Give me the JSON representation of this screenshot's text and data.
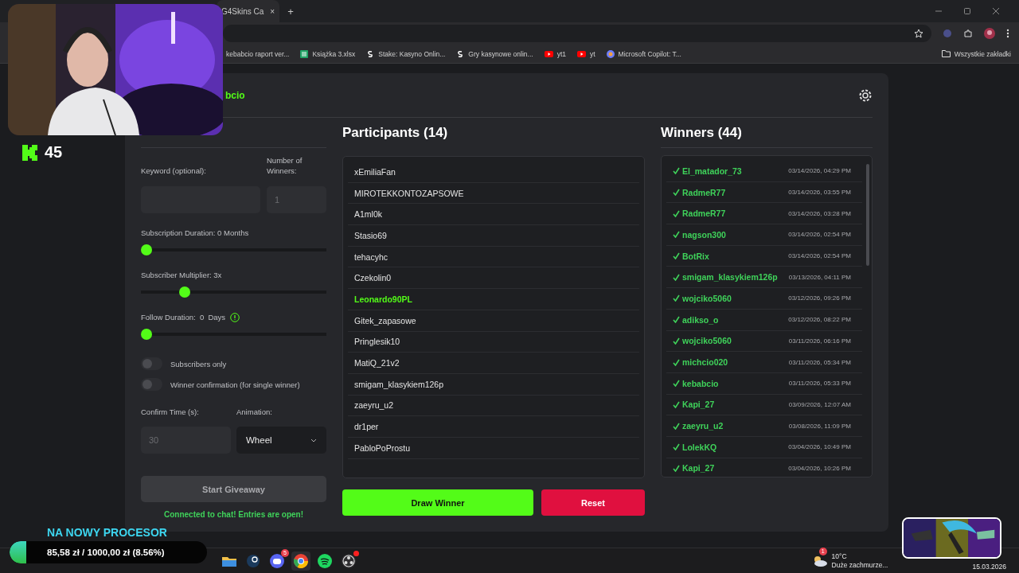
{
  "browser": {
    "tab": {
      "title": "G4Skins Ca",
      "close": "×"
    },
    "new_tab": "+",
    "bookmarks": [
      {
        "kind": "doc",
        "label": "kebabcio raport ver..."
      },
      {
        "kind": "sheet",
        "label": "Książka 3.xlsx"
      },
      {
        "kind": "stake",
        "label": "Stake: Kasyno Onlin..."
      },
      {
        "kind": "stake",
        "label": "Gry kasynowe onlin..."
      },
      {
        "kind": "youtube",
        "label": "yt1"
      },
      {
        "kind": "youtube",
        "label": "yt"
      },
      {
        "kind": "copilot",
        "label": "Microsoft Copilot: T..."
      }
    ],
    "all_bookmarks": "Wszystkie zakładki"
  },
  "app": {
    "header": {
      "name": "bcio"
    },
    "settings": {
      "keyword_label": "Keyword (optional):",
      "winners_label": "Number of Winners:",
      "winners_placeholder": "1",
      "sliders": [
        {
          "label": "Subscription Duration: 0 Months",
          "level": 0
        },
        {
          "label": "Subscriber Multiplier: 3x",
          "level": 0.22
        },
        {
          "label": "Follow Duration:  0  Days",
          "level": 0,
          "info": true
        }
      ],
      "toggles": [
        {
          "label": "Subscribers only",
          "on": false
        },
        {
          "label": "Winner confirmation (for single winner)",
          "on": false
        }
      ],
      "confirm_label": "Confirm Time (s):",
      "confirm_placeholder": "30",
      "animation_label": "Animation:",
      "animation_value": "Wheel",
      "start_button": "Start Giveaway",
      "status": "Connected to chat! Entries are open!"
    },
    "participants": {
      "title": "Participants (14)",
      "items": [
        {
          "name": "xEmiliaFan",
          "highlighted": false
        },
        {
          "name": "MIROTEKKONTOZAPSOWE",
          "highlighted": false
        },
        {
          "name": "A1ml0k",
          "highlighted": false
        },
        {
          "name": "Stasio69",
          "highlighted": false
        },
        {
          "name": "tehacyhc",
          "highlighted": false
        },
        {
          "name": "Czekolin0",
          "highlighted": false
        },
        {
          "name": "Leonardo90PL",
          "highlighted": true
        },
        {
          "name": "Gitek_zapasowe",
          "highlighted": false
        },
        {
          "name": "Pringlesik10",
          "highlighted": false
        },
        {
          "name": "MatiQ_21v2",
          "highlighted": false
        },
        {
          "name": "smigam_klasykiem126p",
          "highlighted": false
        },
        {
          "name": "zaeyru_u2",
          "highlighted": false
        },
        {
          "name": "dr1per",
          "highlighted": false
        },
        {
          "name": "PabloPoProstu",
          "highlighted": false
        }
      ]
    },
    "draw_button": "Draw Winner",
    "reset_button": "Reset",
    "winners": {
      "title": "Winners (44)",
      "items": [
        {
          "name": "El_matador_73",
          "time": "03/14/2026, 04:29 PM"
        },
        {
          "name": "RadmeR77",
          "time": "03/14/2026, 03:55 PM"
        },
        {
          "name": "RadmeR77",
          "time": "03/14/2026, 03:28 PM"
        },
        {
          "name": "nagson300",
          "time": "03/14/2026, 02:54 PM"
        },
        {
          "name": "BotRix",
          "time": "03/14/2026, 02:54 PM"
        },
        {
          "name": "smigam_klasykiem126p",
          "time": "03/13/2026, 04:11 PM"
        },
        {
          "name": "wojciko5060",
          "time": "03/12/2026, 09:26 PM"
        },
        {
          "name": "adikso_o",
          "time": "03/12/2026, 08:22 PM"
        },
        {
          "name": "wojciko5060",
          "time": "03/11/2026, 06:16 PM"
        },
        {
          "name": "michcio020",
          "time": "03/11/2026, 05:34 PM"
        },
        {
          "name": "kebabcio",
          "time": "03/11/2026, 05:33 PM"
        },
        {
          "name": "Kapi_27",
          "time": "03/09/2026, 12:07 AM"
        },
        {
          "name": "zaeyru_u2",
          "time": "03/08/2026, 11:09 PM"
        },
        {
          "name": "LolekKQ",
          "time": "03/04/2026, 10:49 PM"
        },
        {
          "name": "Kapi_27",
          "time": "03/04/2026, 10:26 PM"
        }
      ]
    }
  },
  "overlay": {
    "counter": "45",
    "goal": {
      "title": "NA NOWY PROCESOR",
      "text": "85,58 zł / 1000,00 zł (8.56%)",
      "level": 0.0856
    }
  },
  "taskbar": {
    "apps": [
      {
        "kind": "folder",
        "notification": false
      },
      {
        "kind": "steam",
        "notification": false
      },
      {
        "kind": "discord",
        "badge": "5",
        "notification": false
      },
      {
        "kind": "chrome",
        "notification": false
      },
      {
        "kind": "spotify",
        "notification": false
      },
      {
        "kind": "obs",
        "notification": true
      }
    ],
    "weather": {
      "badge": "1",
      "temp": "10°C",
      "desc": "Duże zachmurze..."
    },
    "date": "15.03.2026"
  }
}
